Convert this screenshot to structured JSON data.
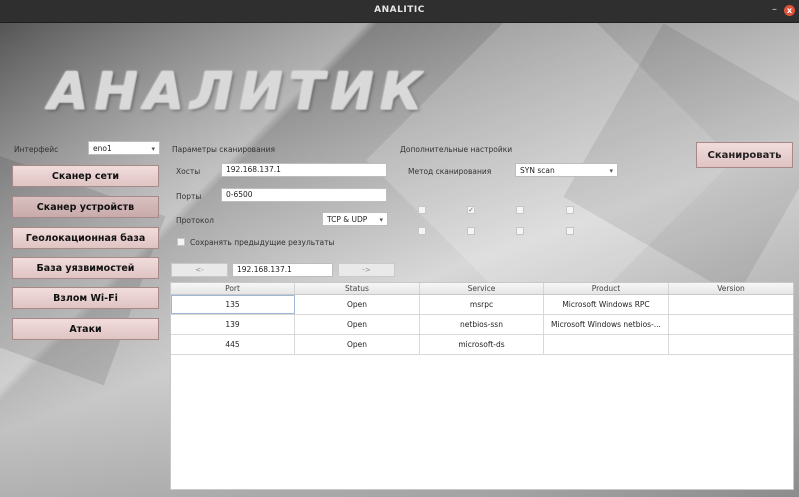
{
  "window": {
    "title": "ANALITIC",
    "minimize": "–",
    "close": "x"
  },
  "logo": "АНАЛИТИК",
  "interface": {
    "label": "Интерфейс",
    "value": "eno1"
  },
  "nav": [
    {
      "label": "Сканер сети"
    },
    {
      "label": "Сканер устройств"
    },
    {
      "label": "Геолокационная база"
    },
    {
      "label": "База уязвимостей"
    },
    {
      "label": "Взлом Wi-Fi"
    },
    {
      "label": "Атаки"
    }
  ],
  "scan_params": {
    "heading": "Параметры сканирования",
    "hosts_label": "Хосты",
    "hosts_value": "192.168.137.1",
    "ports_label": "Порты",
    "ports_value": "0-6500",
    "protocol_label": "Протокол",
    "protocol_value": "TCP & UDP",
    "save_label": "Сохранять предыдущие результаты"
  },
  "extra": {
    "heading": "Дополнительные настройки",
    "method_label": "Метод сканирования",
    "method_value": "SYN scan"
  },
  "scan_button": "Сканировать",
  "pager": {
    "prev": "<-",
    "host": "192.168.137.1",
    "next": "->"
  },
  "table": {
    "columns": [
      "Port",
      "Status",
      "Service",
      "Product",
      "Version"
    ],
    "rows": [
      [
        "135",
        "Open",
        "msrpc",
        "Microsoft Windows RPC",
        ""
      ],
      [
        "139",
        "Open",
        "netbios-ssn",
        "Microsoft Windows netbios-...",
        ""
      ],
      [
        "445",
        "Open",
        "microsoft-ds",
        "",
        ""
      ]
    ]
  }
}
